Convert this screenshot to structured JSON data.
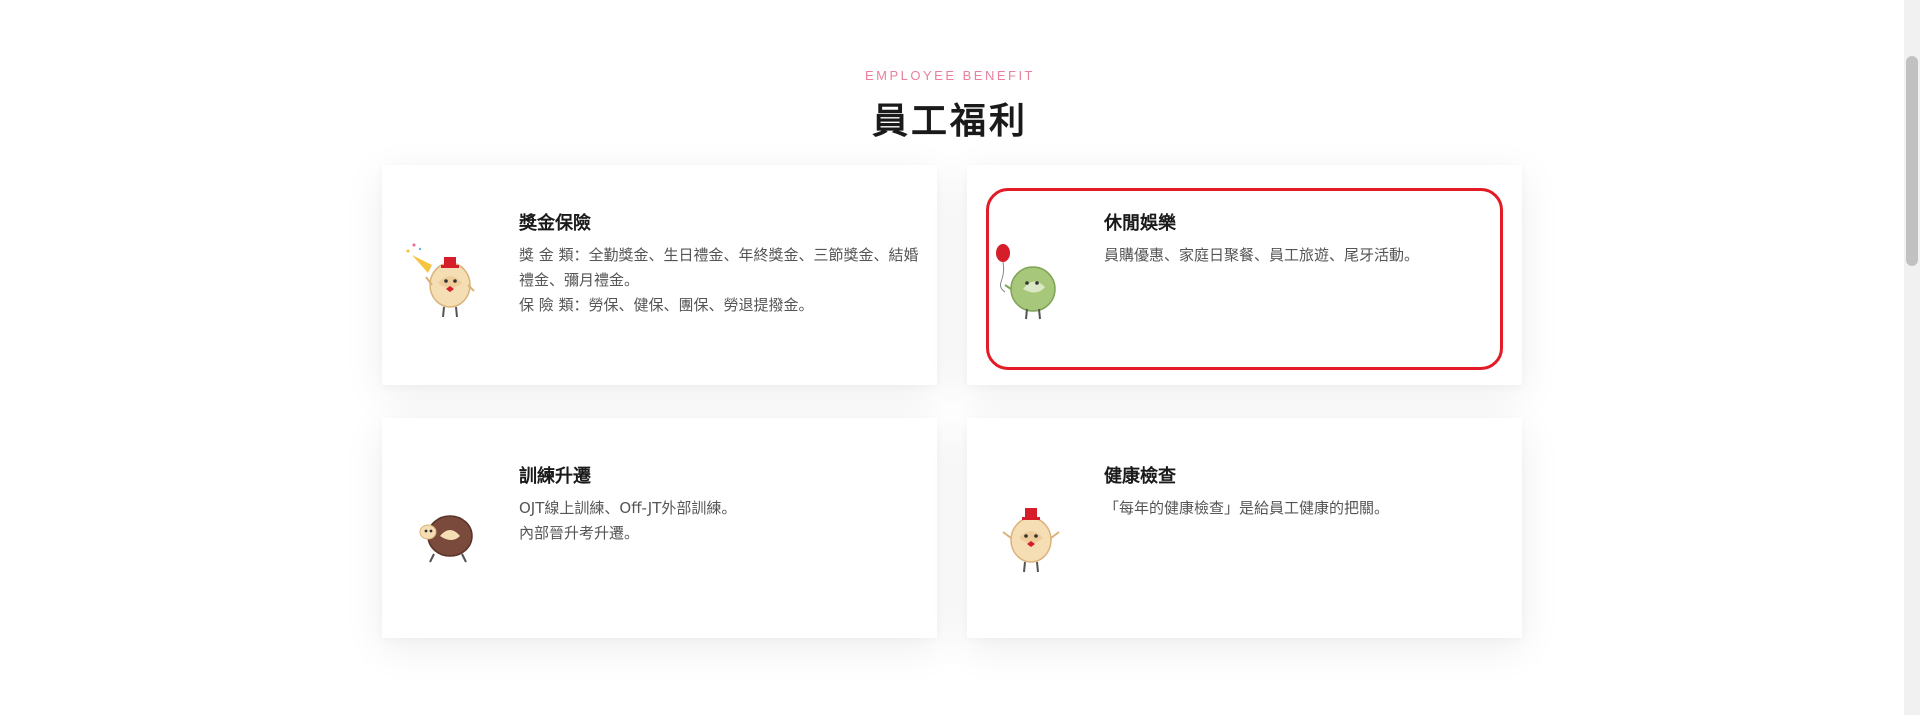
{
  "section": {
    "eyebrow": "EMPLOYEE BENEFIT",
    "title": "員工福利"
  },
  "cards": [
    {
      "title": "獎金保險",
      "lines": [
        "獎 金 類：全勤獎金、生日禮金、年終獎金、三節獎金、結婚禮金、彌月禮金。",
        "保 險 類：勞保、健保、團保、勞退提撥金。"
      ],
      "icon": "mascot-party-horn-icon"
    },
    {
      "title": "休閒娛樂",
      "lines": [
        "員購優惠、家庭日聚餐、員工旅遊、尾牙活動。"
      ],
      "icon": "mascot-balloon-icon"
    },
    {
      "title": "訓練升遷",
      "lines": [
        "OJT線上訓練、Off-JT外部訓練。",
        "內部晉升考升遷。"
      ],
      "icon": "mascot-rolling-icon"
    },
    {
      "title": "健康檢查",
      "lines": [
        "「每年的健康檢查」是給員工健康的把關。"
      ],
      "icon": "mascot-top-hat-icon"
    }
  ],
  "colors": {
    "eyebrow": "#e9809c",
    "highlight": "#e21b26"
  }
}
